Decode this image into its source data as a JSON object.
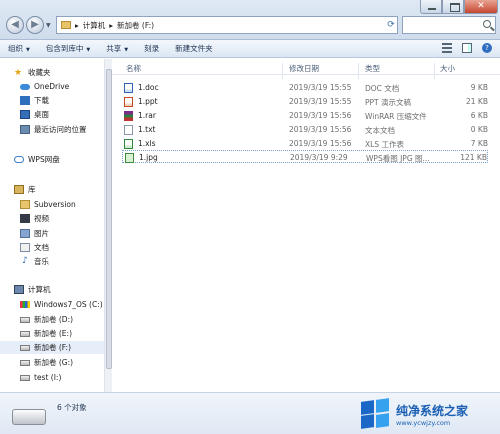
{
  "window": {
    "address_parts": [
      "计算机",
      "新加卷 (F:)"
    ],
    "close_glyph": "✕"
  },
  "toolbar": {
    "organize": "组织",
    "include_in_library": "包含到库中",
    "share": "共享",
    "burn": "刻录",
    "new_folder": "新建文件夹"
  },
  "sidebar": {
    "items": [
      {
        "label": "收藏夹",
        "icon": "star-icon"
      },
      {
        "label": "OneDrive",
        "icon": "cloud-icon"
      },
      {
        "label": "下载",
        "icon": "download-icon"
      },
      {
        "label": "桌面",
        "icon": "desktop-icon"
      },
      {
        "label": "最近访问的位置",
        "icon": "recent-icon"
      },
      {
        "label": "WPS网盘",
        "icon": "wps-cloud-icon"
      },
      {
        "label": "库",
        "icon": "library-icon"
      },
      {
        "label": "Subversion",
        "icon": "folder-icon"
      },
      {
        "label": "视频",
        "icon": "video-icon"
      },
      {
        "label": "图片",
        "icon": "picture-icon"
      },
      {
        "label": "文档",
        "icon": "document-icon"
      },
      {
        "label": "音乐",
        "icon": "music-icon"
      },
      {
        "label": "计算机",
        "icon": "computer-icon"
      },
      {
        "label": "Windows7_OS (C:)",
        "icon": "windows-drive-icon"
      },
      {
        "label": "新加卷 (D:)",
        "icon": "drive-icon"
      },
      {
        "label": "新加卷 (E:)",
        "icon": "drive-icon"
      },
      {
        "label": "新加卷 (F:)",
        "icon": "drive-icon"
      },
      {
        "label": "新加卷 (G:)",
        "icon": "drive-icon"
      },
      {
        "label": "test (I:)",
        "icon": "drive-icon"
      }
    ]
  },
  "columns": {
    "name": "名称",
    "modified": "修改日期",
    "type": "类型",
    "size": "大小"
  },
  "files": [
    {
      "name": "1.doc",
      "modified": "2019/3/19 15:55",
      "type": "DOC 文档",
      "size": "9 KB",
      "icon": "doc-file-icon"
    },
    {
      "name": "1.ppt",
      "modified": "2019/3/19 15:55",
      "type": "PPT 演示文稿",
      "size": "21 KB",
      "icon": "ppt-file-icon"
    },
    {
      "name": "1.rar",
      "modified": "2019/3/19 15:56",
      "type": "WinRAR 压缩文件",
      "size": "6 KB",
      "icon": "rar-file-icon"
    },
    {
      "name": "1.txt",
      "modified": "2019/3/19 15:56",
      "type": "文本文档",
      "size": "0 KB",
      "icon": "txt-file-icon"
    },
    {
      "name": "1.xls",
      "modified": "2019/3/19 15:56",
      "type": "XLS 工作表",
      "size": "7 KB",
      "icon": "xls-file-icon"
    },
    {
      "name": "1.jpg",
      "modified": "2019/3/19 9:29",
      "type": "WPS看图 JPG 图...",
      "size": "121 KB",
      "icon": "jpg-file-icon"
    }
  ],
  "status": {
    "count": "6 个对象"
  },
  "watermark": {
    "title": "纯净系统之家",
    "url": "www.ycwjzy.com"
  }
}
